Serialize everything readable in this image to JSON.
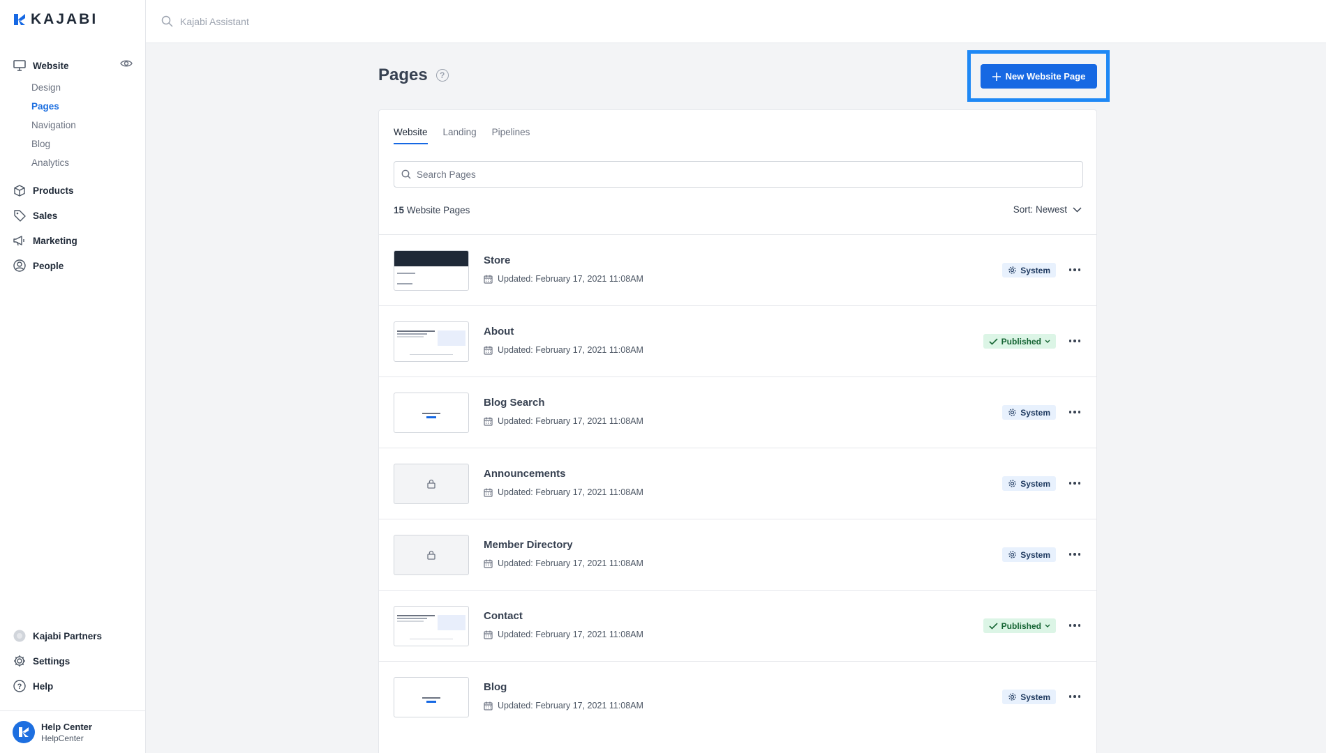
{
  "brand": {
    "logo_text": "KAJABI"
  },
  "topbar": {
    "search_placeholder": "Kajabi Assistant"
  },
  "sidebar": {
    "website": {
      "label": "Website",
      "sub_items": [
        {
          "label": "Design",
          "active": false
        },
        {
          "label": "Pages",
          "active": true
        },
        {
          "label": "Navigation",
          "active": false
        },
        {
          "label": "Blog",
          "active": false
        },
        {
          "label": "Analytics",
          "active": false
        }
      ]
    },
    "items": [
      {
        "label": "Products",
        "icon": "box-icon"
      },
      {
        "label": "Sales",
        "icon": "tag-icon"
      },
      {
        "label": "Marketing",
        "icon": "megaphone-icon"
      },
      {
        "label": "People",
        "icon": "user-circle-icon"
      }
    ],
    "bottom_items": [
      {
        "label": "Kajabi Partners",
        "icon": "partners-icon"
      },
      {
        "label": "Settings",
        "icon": "gear-icon"
      },
      {
        "label": "Help",
        "icon": "question-icon"
      }
    ],
    "footer": {
      "title": "Help Center",
      "subtitle": "HelpCenter"
    }
  },
  "main": {
    "title": "Pages",
    "new_button": "New Website Page",
    "tabs": [
      {
        "label": "Website",
        "active": true
      },
      {
        "label": "Landing",
        "active": false
      },
      {
        "label": "Pipelines",
        "active": false
      }
    ],
    "search_placeholder": "Search Pages",
    "count_number": "15",
    "count_label": "Website Pages",
    "sort_label": "Sort: Newest",
    "rows": [
      {
        "title": "Store",
        "updated": "Updated: February 17, 2021 11:08AM",
        "status": "System",
        "thumb": "store"
      },
      {
        "title": "About",
        "updated": "Updated: February 17, 2021 11:08AM",
        "status": "Published",
        "thumb": "about"
      },
      {
        "title": "Blog Search",
        "updated": "Updated: February 17, 2021 11:08AM",
        "status": "System",
        "thumb": "notfound"
      },
      {
        "title": "Announcements",
        "updated": "Updated: February 17, 2021 11:08AM",
        "status": "System",
        "thumb": "locked"
      },
      {
        "title": "Member Directory",
        "updated": "Updated: February 17, 2021 11:08AM",
        "status": "System",
        "thumb": "locked"
      },
      {
        "title": "Contact",
        "updated": "Updated: February 17, 2021 11:08AM",
        "status": "Published",
        "thumb": "about"
      },
      {
        "title": "Blog",
        "updated": "Updated: February 17, 2021 11:08AM",
        "status": "System",
        "thumb": "notfound"
      }
    ]
  },
  "colors": {
    "primary": "#1668e3",
    "highlight": "#1e88f5",
    "published_bg": "#dcf5e6",
    "system_bg": "#e8f1fd"
  }
}
